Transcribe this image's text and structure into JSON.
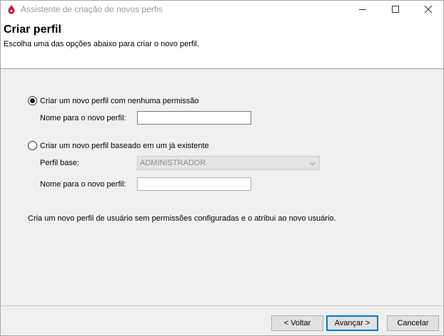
{
  "window": {
    "title": "Assistente de criação de novos perfis"
  },
  "header": {
    "title": "Criar perfil",
    "subtitle": "Escolha uma das opções abaixo para criar o novo perfil."
  },
  "options": {
    "new_empty": {
      "label": "Criar um novo perfil com nenhuma permissão",
      "selected": true,
      "name_label": "Nome para o novo perfil:",
      "name_value": ""
    },
    "based_on_existing": {
      "label": "Criar um novo perfil baseado em um já existente",
      "selected": false,
      "base_label": "Perfil base:",
      "base_value": "ADMINISTRADOR",
      "name_label": "Nome para o novo perfil:",
      "name_value": ""
    }
  },
  "description": "Cria um novo perfil de usuário sem permissões configuradas e o atribui ao novo usuário.",
  "buttons": {
    "back": "< Voltar",
    "next": "Avançar >",
    "cancel": "Cancelar"
  },
  "icons": {
    "app": "red-drop-icon",
    "minimize": "minimize-icon",
    "maximize": "maximize-icon",
    "close": "close-icon"
  },
  "colors": {
    "app_icon": "#c8102e",
    "default_button_border": "#0078d7"
  }
}
